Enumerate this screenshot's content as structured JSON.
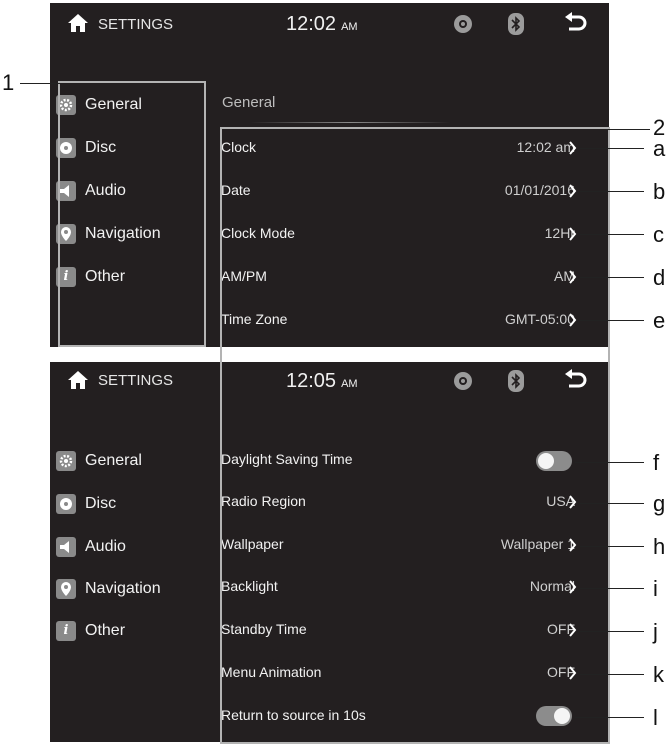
{
  "screen_top": {
    "header": {
      "title": "SETTINGS",
      "time": "12:02",
      "ampm": "AM"
    },
    "section_title": "General",
    "rows": [
      {
        "label": "Clock",
        "value": "12:02 am"
      },
      {
        "label": "Date",
        "value": "01/01/2016"
      },
      {
        "label": "Clock Mode",
        "value": "12Hr"
      },
      {
        "label": "AM/PM",
        "value": "AM"
      },
      {
        "label": "Time Zone",
        "value": "GMT-05:00"
      }
    ]
  },
  "screen_bottom": {
    "header": {
      "title": "SETTINGS",
      "time": "12:05",
      "ampm": "AM"
    },
    "rows": [
      {
        "label": "Daylight Saving Time",
        "value": "",
        "control": "toggle",
        "state": "off"
      },
      {
        "label": "Radio Region",
        "value": "USA"
      },
      {
        "label": "Wallpaper",
        "value": "Wallpaper 1"
      },
      {
        "label": "Backlight",
        "value": "Normal"
      },
      {
        "label": "Standby Time",
        "value": "OFF"
      },
      {
        "label": "Menu Animation",
        "value": "OFF"
      },
      {
        "label": "Return to source in 10s",
        "value": "",
        "control": "toggle",
        "state": "on"
      }
    ]
  },
  "sidebar": {
    "items": [
      {
        "label": "General",
        "icon": "gear-icon"
      },
      {
        "label": "Disc",
        "icon": "disc-icon"
      },
      {
        "label": "Audio",
        "icon": "speaker-icon"
      },
      {
        "label": "Navigation",
        "icon": "location-pin-icon"
      },
      {
        "label": "Other",
        "icon": "info-icon"
      }
    ]
  },
  "header_icons": [
    "home-icon",
    "disc-icon",
    "bluetooth-icon",
    "back-icon"
  ],
  "callouts": {
    "sidebar": "1",
    "settings_list": "2",
    "rows": [
      "a",
      "b",
      "c",
      "d",
      "e",
      "f",
      "g",
      "h",
      "i",
      "j",
      "k",
      "l"
    ]
  },
  "colors": {
    "screen_bg": "#231f20",
    "icon_gray": "#8a8a8a",
    "outline": "#b3b3b3"
  }
}
